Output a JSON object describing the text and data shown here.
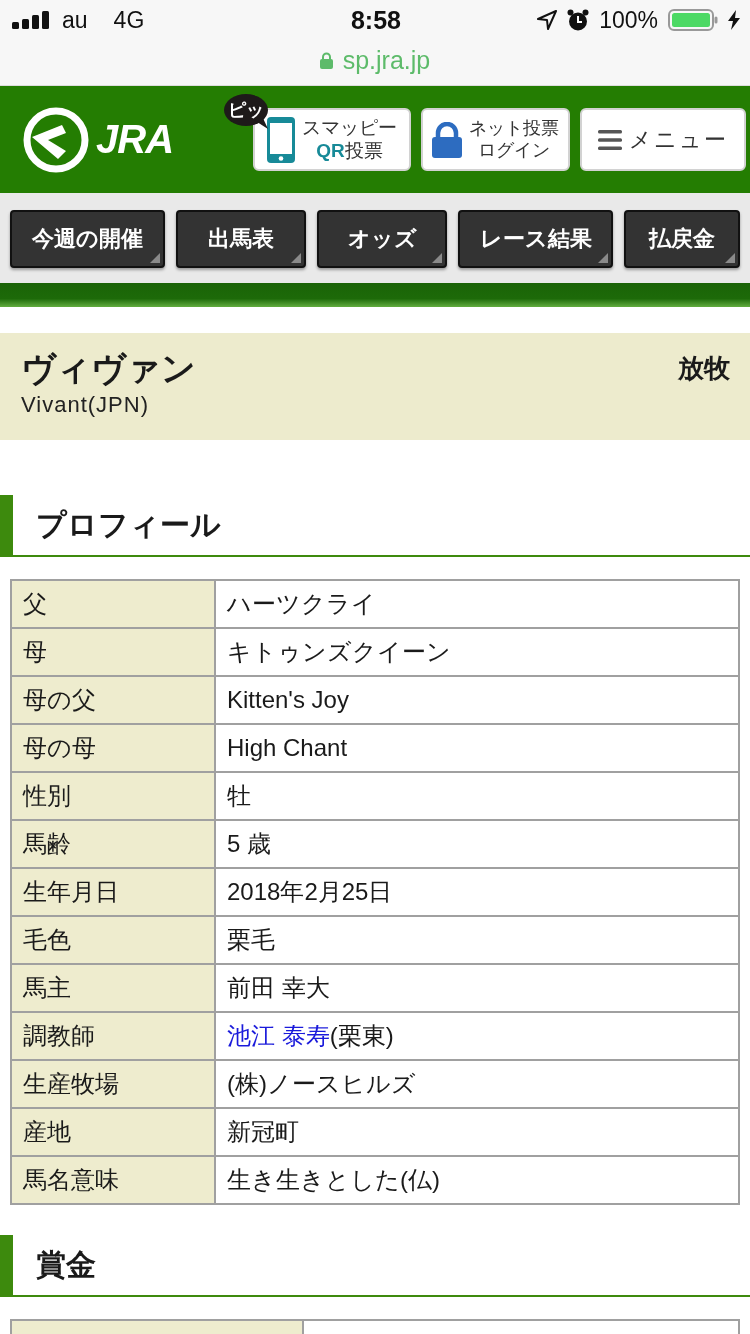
{
  "status_bar": {
    "carrier": "au",
    "network": "4G",
    "time": "8:58",
    "battery": "100%"
  },
  "address_bar": {
    "url": "sp.jra.jp"
  },
  "header": {
    "logo": "JRA",
    "buttons": [
      {
        "kind": "qr",
        "title": "スマッピー",
        "accent": "QR",
        "subtitle": "投票",
        "badge": "ピッ"
      },
      {
        "kind": "login",
        "title": "ネット投票",
        "subtitle": "ログイン"
      },
      {
        "kind": "menu",
        "title": "メニュー"
      }
    ]
  },
  "nav": [
    {
      "label": "今週の開催"
    },
    {
      "label": "出馬表"
    },
    {
      "label": "オッズ"
    },
    {
      "label": "レース結果"
    },
    {
      "label": "払戻金"
    }
  ],
  "horse": {
    "name": "ヴィヴァン",
    "name_en": "Vivant(JPN)",
    "status": "放牧"
  },
  "profile": {
    "title": "プロフィール",
    "rows": [
      {
        "kind": "text",
        "label": "父",
        "value": "ハーツクライ"
      },
      {
        "kind": "text",
        "label": "母",
        "value": "キトゥンズクイーン"
      },
      {
        "kind": "text",
        "label": "母の父",
        "value": "Kitten's Joy"
      },
      {
        "kind": "text",
        "label": "母の母",
        "value": "High Chant"
      },
      {
        "kind": "text",
        "label": "性別",
        "value": "牡"
      },
      {
        "kind": "text",
        "label": "馬齢",
        "value": "5 歳"
      },
      {
        "kind": "text",
        "label": "生年月日",
        "value": "2018年2月25日"
      },
      {
        "kind": "text",
        "label": "毛色",
        "value": "栗毛"
      },
      {
        "kind": "text",
        "label": "馬主",
        "value": "前田 幸大"
      },
      {
        "kind": "link",
        "label": "調教師",
        "link": "池江 泰寿",
        "value": "(栗東)"
      },
      {
        "kind": "text",
        "label": "生産牧場",
        "value": "(株)ノースヒルズ"
      },
      {
        "kind": "text",
        "label": "産地",
        "value": "新冠町"
      },
      {
        "kind": "text",
        "label": "馬名意味",
        "value": "生き生きとした(仏)"
      }
    ]
  },
  "prize": {
    "title": "賞金"
  }
}
